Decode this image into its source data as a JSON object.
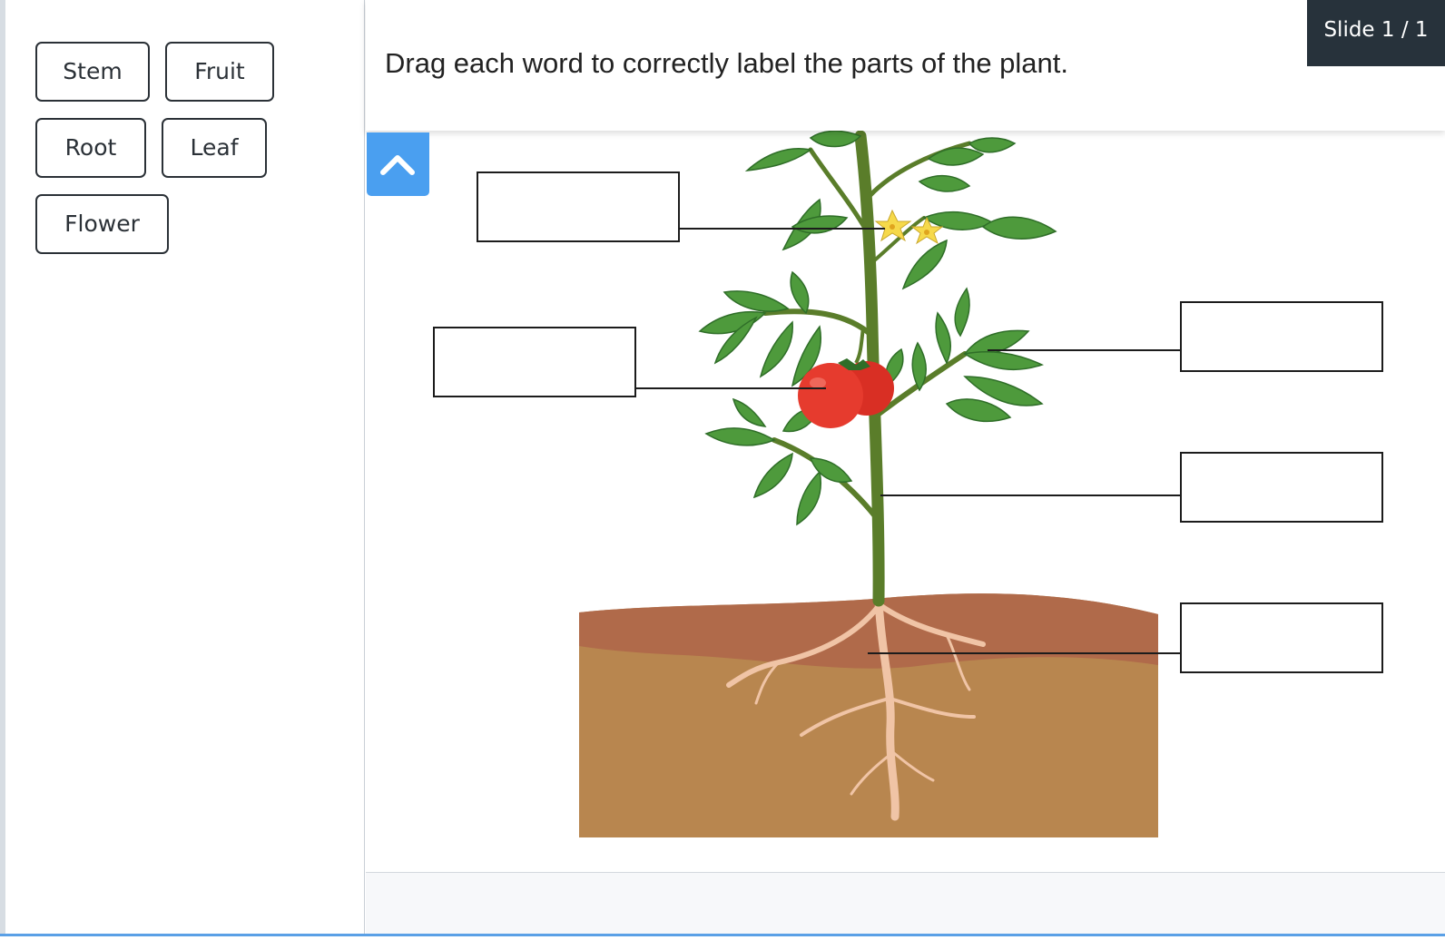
{
  "word_bank": {
    "chips": [
      {
        "label": "Stem"
      },
      {
        "label": "Fruit"
      },
      {
        "label": "Root"
      },
      {
        "label": "Leaf"
      },
      {
        "label": "Flower"
      }
    ]
  },
  "header": {
    "instruction": "Drag each word to correctly label the parts of the plant.",
    "slide_indicator": "Slide 1 / 1"
  },
  "collapse_button": {
    "icon": "chevron-up-icon",
    "color": "#4a9ff0"
  },
  "diagram": {
    "drop_targets": [
      {
        "label": ""
      },
      {
        "label": ""
      },
      {
        "label": ""
      },
      {
        "label": ""
      },
      {
        "label": ""
      }
    ],
    "colors": {
      "leaf": "#4e9a3c",
      "leaf_dark": "#2f6e28",
      "stem": "#5a7d2a",
      "fruit": "#e63b2e",
      "flower": "#f6d94a",
      "soil_top": "#b06a4a",
      "soil": "#b8864f",
      "root": "#f0c4a6"
    }
  }
}
